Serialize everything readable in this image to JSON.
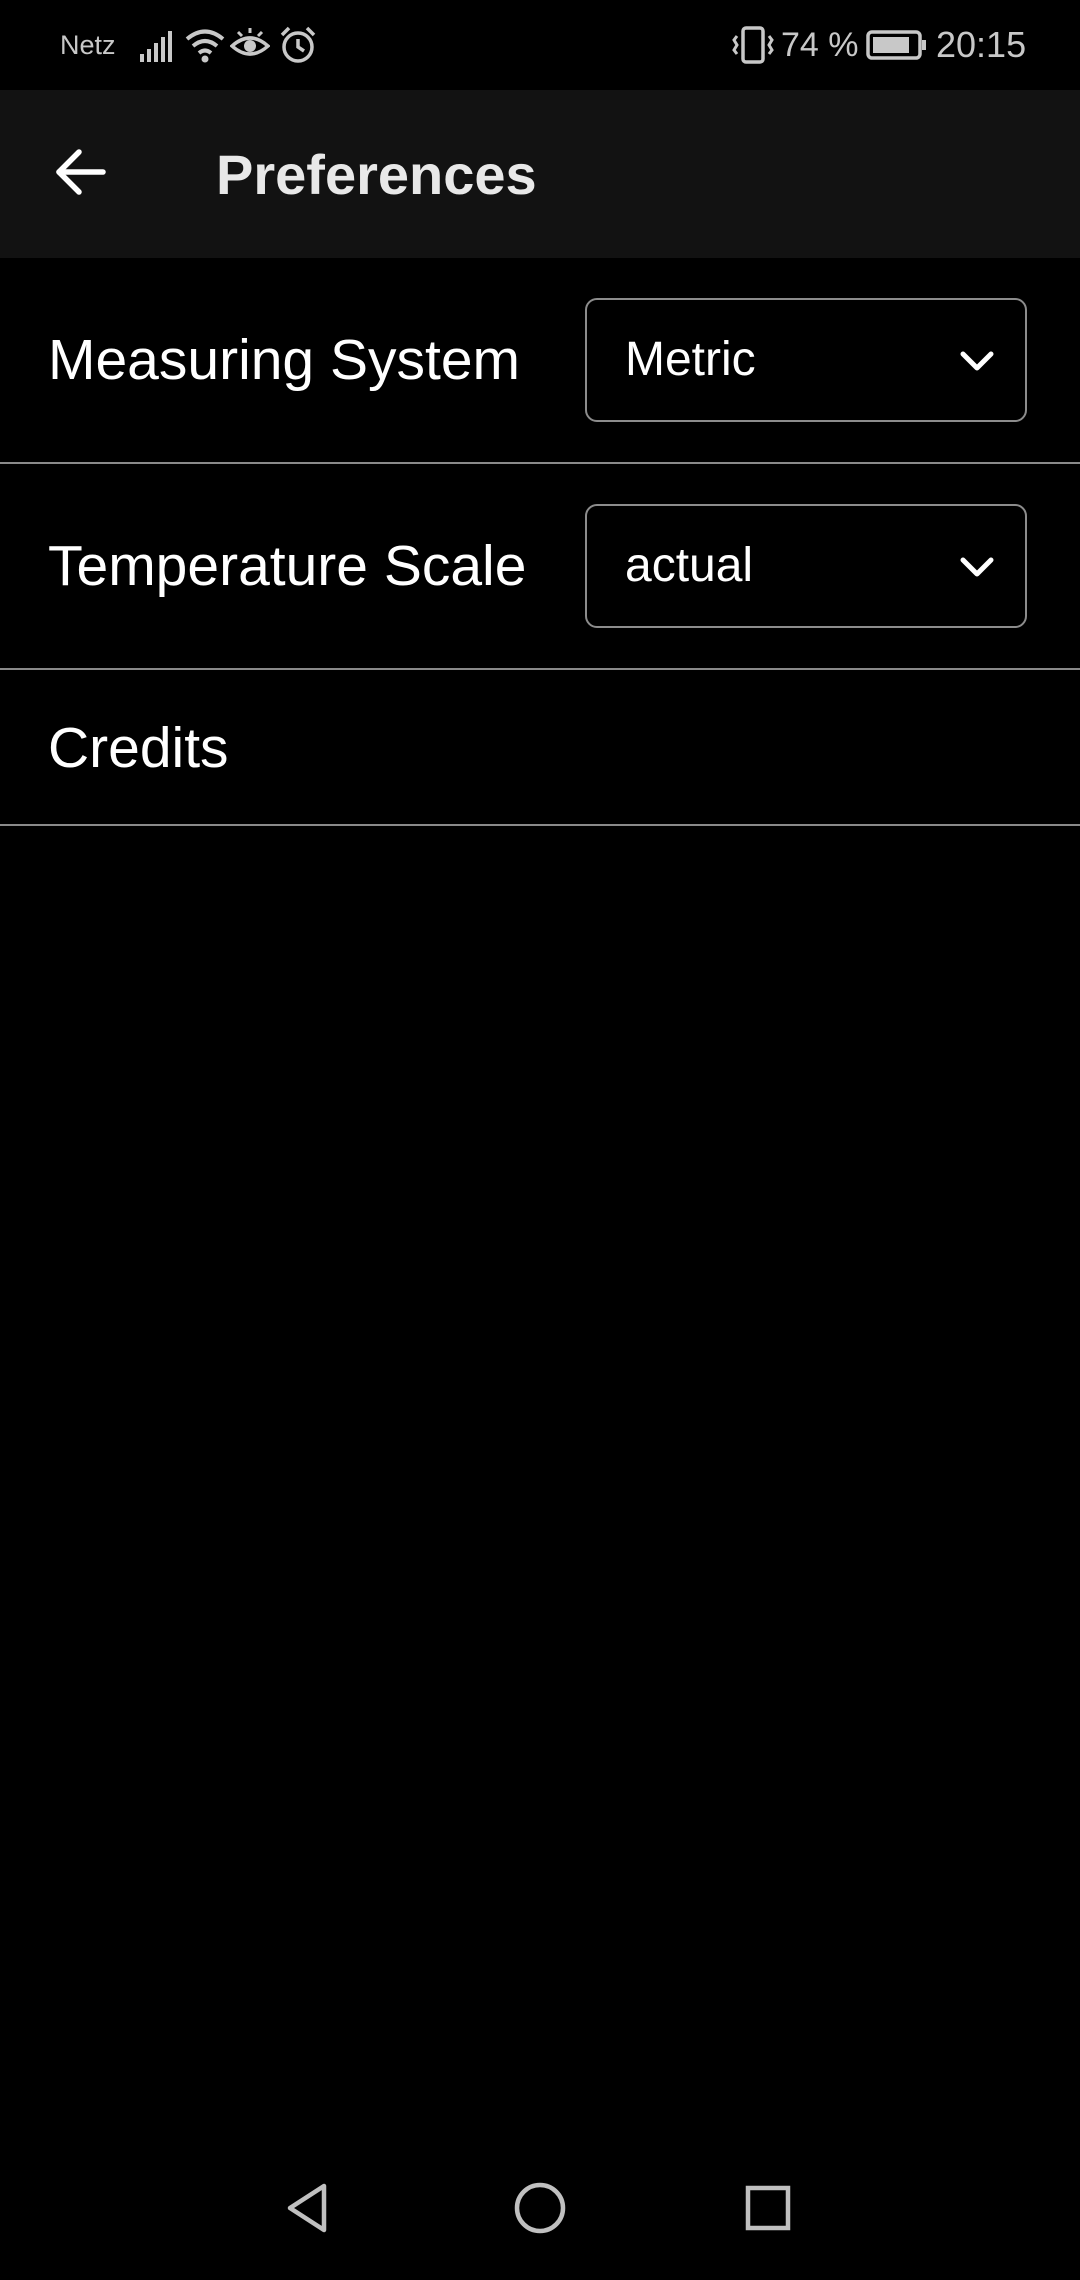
{
  "status_bar": {
    "carrier": "Netz",
    "battery": "74 %",
    "time": "20:15",
    "icons": [
      "signal-icon",
      "wifi-icon",
      "eye-icon",
      "alarm-icon",
      "vibrate-icon",
      "battery-icon"
    ]
  },
  "app_bar": {
    "title": "Preferences",
    "back_icon": "arrow-left-icon"
  },
  "settings": {
    "measuring_system": {
      "label": "Measuring System",
      "value": "Metric"
    },
    "temperature_scale": {
      "label": "Temperature Scale",
      "value": "actual"
    },
    "credits": {
      "label": "Credits"
    }
  },
  "nav_bar": {
    "icons": [
      "back-triangle-icon",
      "home-circle-icon",
      "recents-square-icon"
    ]
  },
  "colors": {
    "background": "#000000",
    "app_bar": "#121212",
    "divider": "#8a8a8a",
    "text": "#ffffff"
  }
}
